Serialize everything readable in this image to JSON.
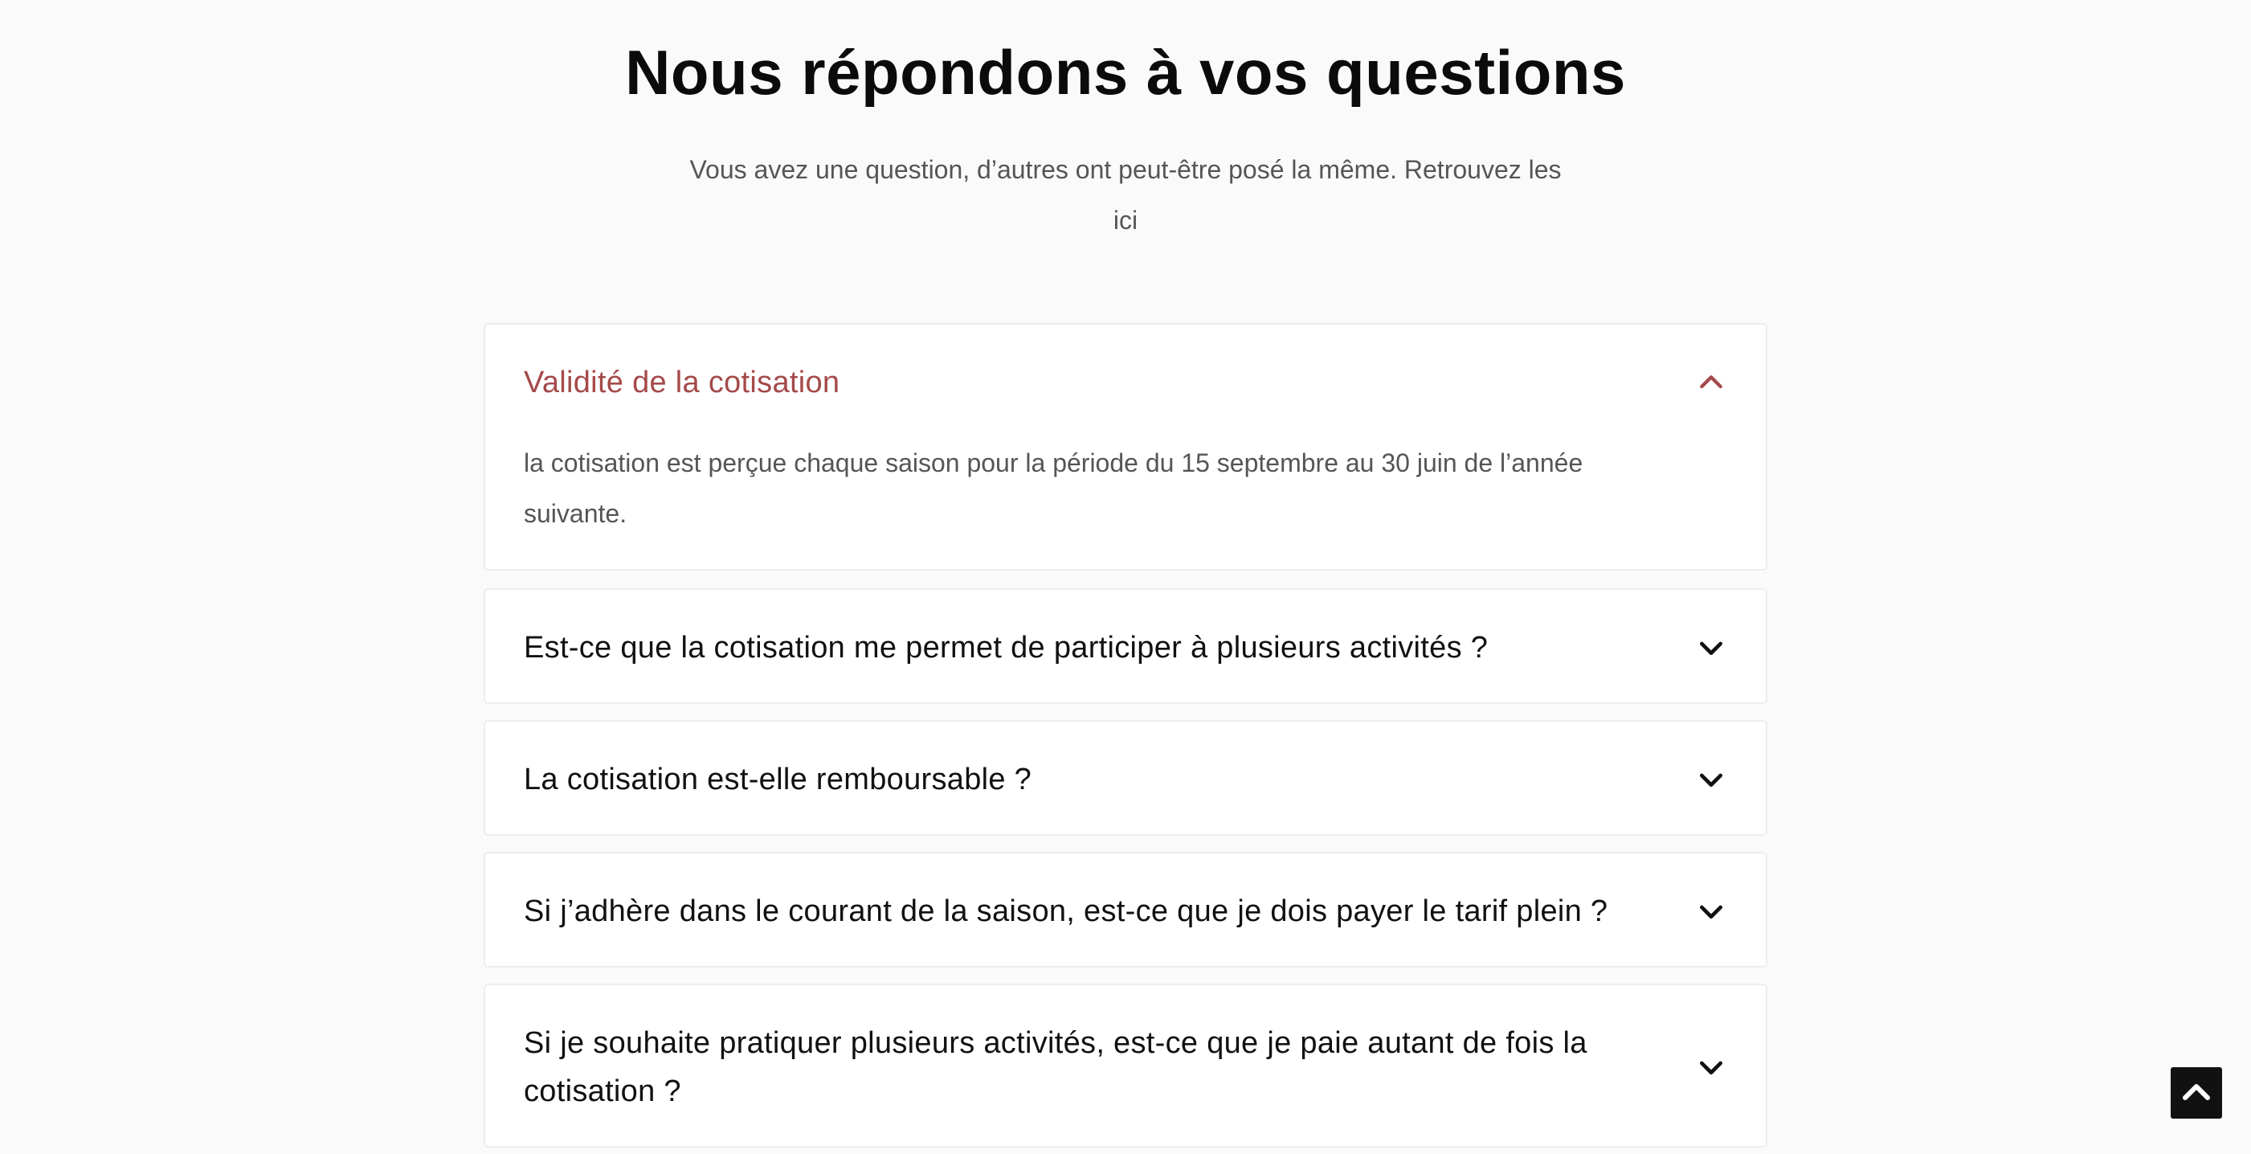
{
  "section": {
    "title": "Nous répondons à vos questions",
    "subtitle": "Vous avez une question, d’autres ont peut-être posé la même. Retrouvez les ici"
  },
  "faqs": [
    {
      "question": "Validité de la cotisation",
      "answer": "la cotisation est perçue chaque saison pour la période du 15 septembre au 30 juin de l’année suivante.",
      "expanded": true,
      "icon": "chevron-up-icon"
    },
    {
      "question": "Est-ce que la cotisation me permet de participer à plusieurs activités ?",
      "expanded": false,
      "icon": "chevron-down-icon"
    },
    {
      "question": "La cotisation est-elle remboursable ?",
      "expanded": false,
      "icon": "chevron-down-icon"
    },
    {
      "question": "Si j’adhère dans le courant de la saison, est-ce que je dois payer le tarif plein ?",
      "expanded": false,
      "icon": "chevron-down-icon"
    },
    {
      "question": "Si je souhaite pratiquer plusieurs activités, est-ce que je paie autant de fois la cotisation ?",
      "expanded": false,
      "icon": "chevron-down-icon"
    }
  ],
  "colors": {
    "background": "#fafafa",
    "card": "#ffffff",
    "accent": "#a54a4a",
    "text": "#111111",
    "muted": "#555555"
  },
  "scroll_top": {
    "icon": "chevron-up-icon"
  }
}
